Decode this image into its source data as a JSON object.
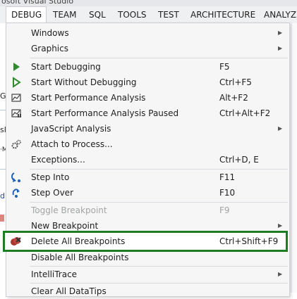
{
  "window": {
    "title": "osoft Visual Studio"
  },
  "menubar": [
    {
      "label": "DEBUG",
      "active": true
    },
    {
      "label": "TEAM"
    },
    {
      "label": "SQL"
    },
    {
      "label": "TOOLS"
    },
    {
      "label": "TEST"
    },
    {
      "label": "ARCHITECTURE"
    },
    {
      "label": "ANALYZE"
    }
  ],
  "background": {
    "frag1": "G",
    "frag2": "sl",
    "frag3": "·M",
    "frag4": "d"
  },
  "menu": {
    "windows": {
      "label": "Windows"
    },
    "graphics": {
      "label": "Graphics"
    },
    "start_debugging": {
      "label": "Start Debugging",
      "shortcut": "F5",
      "icon": "play-icon"
    },
    "start_without_debugging": {
      "label": "Start Without Debugging",
      "shortcut": "Ctrl+F5",
      "icon": "play-outline-icon"
    },
    "start_perf": {
      "label": "Start Performance Analysis",
      "shortcut": "Alt+F2",
      "icon": "performance-icon"
    },
    "start_perf_paused": {
      "label": "Start Performance Analysis Paused",
      "shortcut": "Ctrl+Alt+F2",
      "icon": "performance-paused-icon"
    },
    "js_analysis": {
      "label": "JavaScript Analysis"
    },
    "attach": {
      "label": "Attach to Process...",
      "icon": "gears-icon"
    },
    "exceptions": {
      "label": "Exceptions...",
      "shortcut": "Ctrl+D, E"
    },
    "step_into": {
      "label": "Step Into",
      "shortcut": "F11",
      "icon": "step-into-icon"
    },
    "step_over": {
      "label": "Step Over",
      "shortcut": "F10",
      "icon": "step-over-icon"
    },
    "toggle_bp": {
      "label": "Toggle Breakpoint",
      "shortcut": "F9",
      "disabled": true
    },
    "new_bp": {
      "label": "New Breakpoint"
    },
    "delete_all_bp": {
      "label": "Delete All Breakpoints",
      "shortcut": "Ctrl+Shift+F9",
      "icon": "delete-breakpoints-icon"
    },
    "disable_all_bp": {
      "label": "Disable All Breakpoints"
    },
    "intellitrace": {
      "label": "IntelliTrace"
    },
    "clear_datatips": {
      "label": "Clear All DataTips"
    }
  },
  "colors": {
    "highlight_border": "#1e7d23",
    "play_green": "#2e8b2e",
    "icon_blue": "#1f5fb4"
  }
}
